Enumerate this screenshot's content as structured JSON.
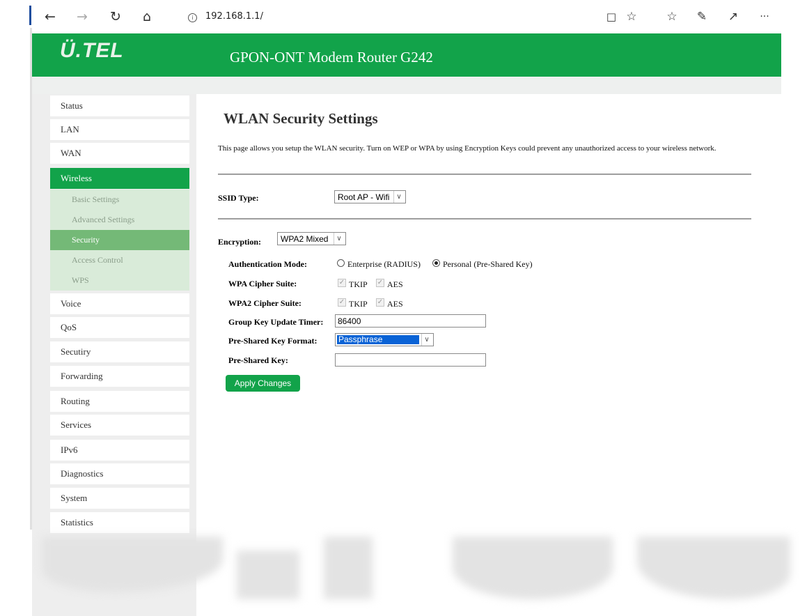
{
  "browser": {
    "url": "192.168.1.1/",
    "back_glyph": "←",
    "forward_glyph": "→",
    "refresh_glyph": "↻",
    "home_glyph": "⌂",
    "info_glyph": "i",
    "reading_glyph": "□",
    "favorite_glyph": "☆",
    "favorites_glyph": "☆",
    "pen_glyph": "✎",
    "share_glyph": "↗",
    "more_glyph": "···"
  },
  "header": {
    "logo_text": "Ü.TEL",
    "title": "GPON-ONT Modem Router G242"
  },
  "sidebar": {
    "items": [
      {
        "label": "Status"
      },
      {
        "label": "LAN"
      },
      {
        "label": "WAN"
      },
      {
        "label": "Wireless"
      },
      {
        "label": "Voice"
      },
      {
        "label": "QoS"
      },
      {
        "label": "Secutiry"
      },
      {
        "label": "Forwarding"
      },
      {
        "label": "Routing"
      },
      {
        "label": "Services"
      },
      {
        "label": "IPv6"
      },
      {
        "label": "Diagnostics"
      },
      {
        "label": "System"
      },
      {
        "label": "Statistics"
      }
    ],
    "subitems": [
      {
        "label": "Basic Settings"
      },
      {
        "label": "Advanced Settings"
      },
      {
        "label": "Security"
      },
      {
        "label": "Access Control"
      },
      {
        "label": "WPS"
      }
    ]
  },
  "main": {
    "title": "WLAN Security Settings",
    "description": "This page allows you setup the WLAN security. Turn on WEP or WPA by using Encryption Keys could prevent any unauthorized access to your wireless network.",
    "ssid_type": {
      "label": "SSID Type:",
      "value": "Root AP - Wifi"
    },
    "encryption": {
      "label": "Encryption:",
      "value": "WPA2 Mixed"
    },
    "auth_mode": {
      "label": "Authentication Mode:",
      "options": [
        "Enterprise (RADIUS)",
        "Personal (Pre-Shared Key)"
      ],
      "selected": "Personal (Pre-Shared Key)"
    },
    "wpa_cipher": {
      "label": "WPA Cipher Suite:",
      "options": [
        "TKIP",
        "AES"
      ]
    },
    "wpa2_cipher": {
      "label": "WPA2 Cipher Suite:",
      "options": [
        "TKIP",
        "AES"
      ]
    },
    "group_key_timer": {
      "label": "Group Key Update Timer:",
      "value": "86400"
    },
    "psk_format": {
      "label": "Pre-Shared Key Format:",
      "value": "Passphrase"
    },
    "psk": {
      "label": "Pre-Shared Key:",
      "value": ""
    },
    "apply_label": "Apply Changes"
  },
  "colors": {
    "brand_green": "#12a34a",
    "submenu_bg": "#d9ebd9",
    "submenu_active": "#74b977"
  }
}
